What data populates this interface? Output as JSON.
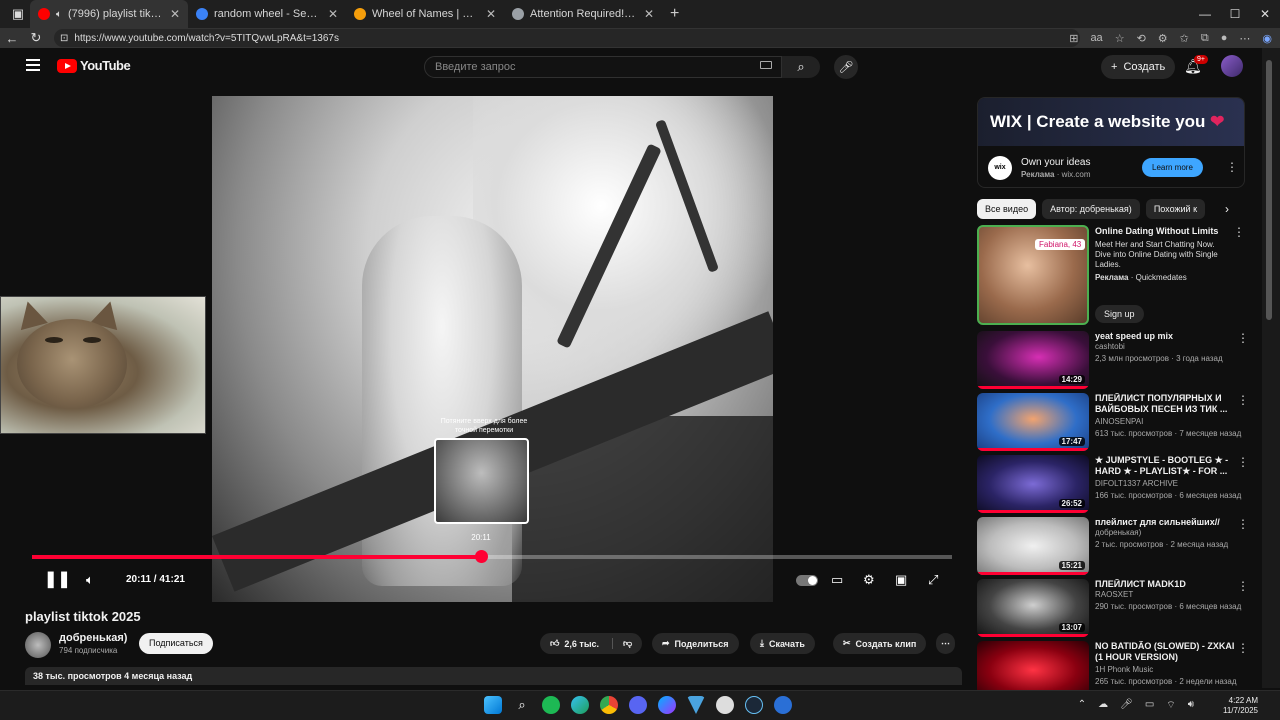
{
  "browser": {
    "tabs": [
      {
        "label": "(7996) playlist tiktok 2025 -",
        "color": "#ff0000",
        "active": true
      },
      {
        "label": "random wheel - Search",
        "color": "#3b82f6",
        "active": false
      },
      {
        "label": "Wheel of Names | Random name",
        "color": "#f59e0b",
        "active": false
      },
      {
        "label": "Attention Required! | Cloudflare",
        "color": "#9aa0a6",
        "active": false
      }
    ],
    "url": "https://www.youtube.com/watch?v=5TITQvwLpRA&t=1367s",
    "reader_label": "aа"
  },
  "youtube": {
    "logo": "YouTube",
    "search_placeholder": "Введите запрос",
    "create_label": "Создать",
    "notifications": "9+"
  },
  "player": {
    "scrub_tip": "Потяните вверх для более точной перемотки",
    "scrub_time": "20:11",
    "time_display": "20:11 / 41:21",
    "progress_fraction": 0.488,
    "accent": "#ff0033"
  },
  "video_info": {
    "title": "playlist tiktok 2025",
    "channel": "добренькая)",
    "subscribers": "794 подписчика",
    "subscribe_label": "Подписаться",
    "likes": "2,6 тыс.",
    "share_label": "Поделиться",
    "download_label": "Скачать",
    "clip_label": "Создать клип",
    "meta": "38 тыс. просмотров  4 месяца назад"
  },
  "sidebar": {
    "ad": {
      "banner": "WIX | Create a website you",
      "logo": "wix",
      "title": "Own your ideas",
      "sponsored": "Реклама",
      "domain": "wix.com",
      "button": "Learn more"
    },
    "chips": [
      "Все видео",
      "Автор: добренькая)",
      "Похожий к"
    ],
    "promo": {
      "tag": "Fabiana, 43",
      "title": "Online Dating Without Limits",
      "desc": "Meet Her and Start Chatting Now. Dive into Online Dating with Single Ladies.",
      "sponsored": "Реклама",
      "advertiser": "Quickmedates",
      "button": "Sign up"
    },
    "recs": [
      {
        "title": "yeat speed up mix",
        "channel": "cashtobi",
        "meta": "2,3 млн просмотров · 3 года назад",
        "duration": "14:29",
        "thumb": "radial-gradient(ellipse at 55% 45%, #d62fb4, #3a0f3a 60%, #111)"
      },
      {
        "title": "ПЛЕЙЛИСТ ПОПУЛЯРНЫХ И ВАЙБОВЫХ ПЕСЕН ИЗ ТИК ...",
        "channel": "AINOSENPAI",
        "meta": "613 тыс. просмотров · 7 месяцев назад",
        "duration": "17:47",
        "thumb": "radial-gradient(ellipse at 50% 45%, #f2a36f, #2f6ec8 55%, #1a3d80)"
      },
      {
        "title": "★ JUMPSTYLE - BOOTLEG ★ - HARD ★ - PLAYLIST★ - FOR ...",
        "channel": "DIFOLT1337 ARCHIVE",
        "meta": "166 тыс. просмотров · 6 месяцев назад",
        "duration": "26:52",
        "thumb": "radial-gradient(ellipse at 50% 50%, #7c6bd6, #2b2466 55%, #0d0b22)"
      },
      {
        "title": "плейлист для сильнейших//",
        "channel": "добренькая)",
        "meta": "2 тыс. просмотров · 2 месяца назад",
        "duration": "15:21",
        "thumb": "radial-gradient(ellipse at 50% 50%, #f0f0f0, #bcbcbc 55%, #777)"
      },
      {
        "title": "ПЛЕЙЛИСТ MADK1D",
        "channel": "RAOSXET",
        "meta": "290 тыс. просмотров · 6 месяцев назад",
        "duration": "13:07",
        "thumb": "radial-gradient(ellipse at 50% 45%, #cfcfcf, #444 55%, #111)"
      },
      {
        "title": "NO BATIDÃO (SLOWED) - ZXKAI (1 HOUR VERSION)",
        "channel": "1H Phonk Music",
        "meta": "265 тыс. просмотров · 2 недели назад",
        "duration": "",
        "thumb": "radial-gradient(ellipse at 50% 50%, #ff3344, #8a0010 55%, #2a0005)"
      }
    ]
  },
  "taskbar": {
    "time": "4:22 AM",
    "date": "11/7/2025"
  }
}
